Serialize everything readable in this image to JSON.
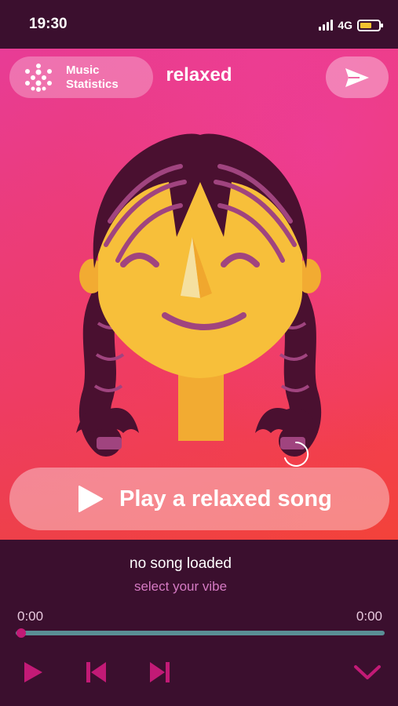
{
  "status_bar": {
    "time": "19:30",
    "network": "4G"
  },
  "header": {
    "stats_button_label": "Music Statistics",
    "stats_line1": "Music",
    "stats_line2": "Statistics",
    "mood": "relaxed"
  },
  "play_button": {
    "label": "Play a relaxed song"
  },
  "player": {
    "song_title": "no song loaded",
    "song_subtitle": "select your vibe",
    "elapsed": "0:00",
    "duration": "0:00",
    "progress": 0
  },
  "icons": [
    "grid-dots-icon",
    "send-icon",
    "play-icon",
    "skip-back-icon",
    "skip-forward-icon",
    "chevron-down-icon"
  ],
  "colors": {
    "accent": "#c21a76",
    "background": "#3b0f2e",
    "subtitle": "#d57ac3",
    "track": "#5a8e95"
  }
}
